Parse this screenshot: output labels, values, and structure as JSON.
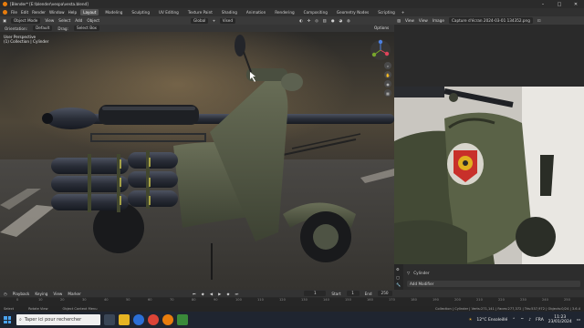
{
  "window": {
    "title": "[Blender* [E:\\blender\\vespa\\vesta.blend]"
  },
  "menus": [
    "File",
    "Edit",
    "Render",
    "Window",
    "Help"
  ],
  "workspaces": [
    {
      "label": "Layout",
      "active": true
    },
    {
      "label": "Modeling",
      "active": false
    },
    {
      "label": "Sculpting",
      "active": false
    },
    {
      "label": "UV Editing",
      "active": false
    },
    {
      "label": "Texture Paint",
      "active": false
    },
    {
      "label": "Shading",
      "active": false
    },
    {
      "label": "Animation",
      "active": false
    },
    {
      "label": "Rendering",
      "active": false
    },
    {
      "label": "Compositing",
      "active": false
    },
    {
      "label": "Geometry Nodes",
      "active": false
    },
    {
      "label": "Scripting",
      "active": false
    }
  ],
  "scene": {
    "label": "Scene"
  },
  "view_layer": {
    "label": "ViewLayer"
  },
  "viewport_header": {
    "mode": "Object Mode",
    "items": [
      "View",
      "Select",
      "Add",
      "Object"
    ],
    "transform": "Global",
    "snap": "Vised"
  },
  "viewport_tools": {
    "orientation_label": "Orientation:",
    "orientation": "Default",
    "drag_label": "Drag:",
    "drag": "Select Box",
    "options": "Options"
  },
  "viewport_info": {
    "line1": "User Perspective",
    "line2": "(1) Collection | Cylinder"
  },
  "image_editor": {
    "items": [
      "View",
      "View",
      "Image"
    ],
    "image_name": "Capture d'écran 2024-03-01 134352.png"
  },
  "properties": {
    "object": "Cylinder",
    "modifier": "Add Modifier"
  },
  "timeline": {
    "items": [
      "Playback",
      "Keying",
      "View",
      "Marker"
    ],
    "current_frame": "1",
    "start_label": "Start",
    "start": "1",
    "end_label": "End",
    "end": "250",
    "ticks": [
      "0",
      "10",
      "20",
      "30",
      "40",
      "50",
      "60",
      "70",
      "80",
      "90",
      "100",
      "110",
      "120",
      "130",
      "140",
      "150",
      "160",
      "170",
      "180",
      "190",
      "200",
      "210",
      "220",
      "230",
      "240",
      "250"
    ]
  },
  "status": {
    "select": "Select",
    "rotate": "Rotate View",
    "context": "Object Context Menu",
    "right": "Collection | Cylinder | Verts:271,141 | Faces:277,372 | Tris:537,972 | Objects:0/24 | 3.6.4"
  },
  "taskbar": {
    "search_placeholder": "Taper ici pour rechercher",
    "weather": "12°C  Ensoleillé",
    "lang": "FRA",
    "time": "11:23",
    "date": "23/01/2024"
  }
}
